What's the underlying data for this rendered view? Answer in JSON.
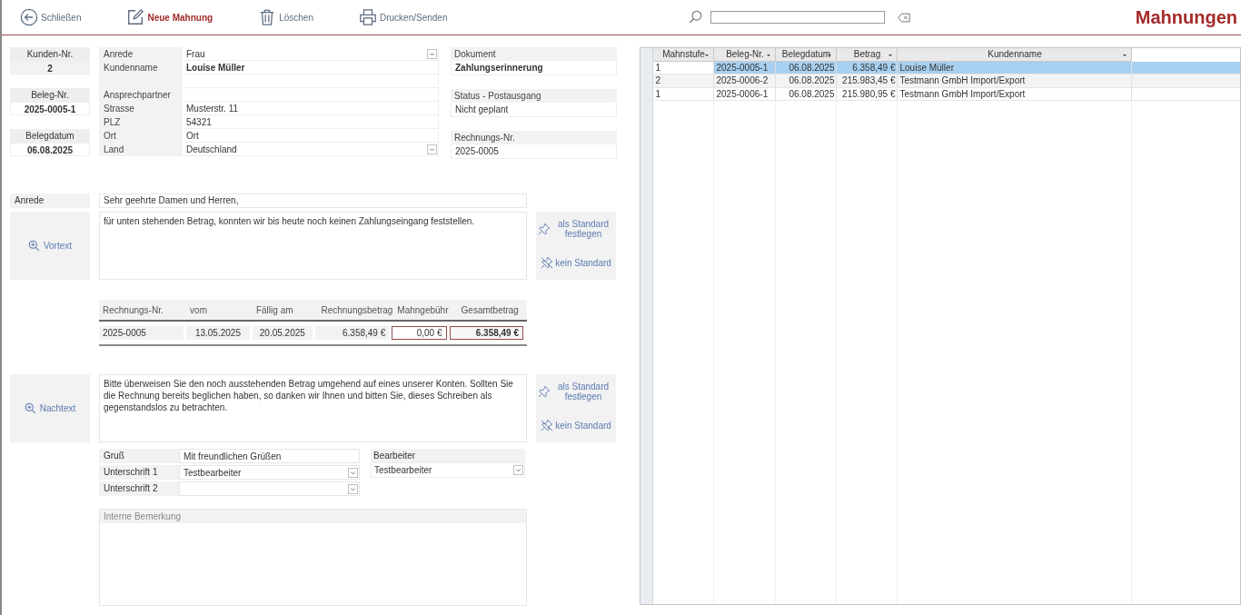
{
  "toolbar": {
    "buttons": [
      {
        "kind": "close",
        "label": "Schließen",
        "selected": false
      },
      {
        "kind": "new",
        "label": "Neue Mahnung",
        "selected": true
      },
      {
        "kind": "delete",
        "label": "Löschen",
        "selected": false
      },
      {
        "kind": "print",
        "label": "Drucken/Senden",
        "selected": false
      }
    ],
    "title": "Mahnungen"
  },
  "ids": [
    {
      "label": "Kunden-Nr.",
      "value": "2"
    },
    {
      "label": "Beleg-Nr.",
      "value": "2025-0005-1"
    },
    {
      "label": "Belegdatum",
      "value": "06.08.2025"
    }
  ],
  "address": [
    {
      "kind": "combo",
      "label": "Anrede",
      "value": "Frau",
      "bold": false
    },
    {
      "kind": "text",
      "label": "Kundenname",
      "value": "Louise Müller",
      "bold": true
    },
    {
      "kind": "blank"
    },
    {
      "kind": "text",
      "label": "Ansprechpartner"
    },
    {
      "kind": "text",
      "label": "Strasse",
      "value": "Musterstr. 11",
      "bold": false
    },
    {
      "kind": "text",
      "label": "PLZ",
      "value": "54321",
      "bold": false
    },
    {
      "kind": "text",
      "label": "Ort",
      "value": "Ort",
      "bold": false
    },
    {
      "kind": "combo",
      "label": "Land",
      "value": "Deutschland",
      "bold": false
    }
  ],
  "info": [
    {
      "label": "Dokument",
      "value": "Zahlungserinnerung",
      "bold": true
    },
    {
      "label": "Status - Postausgang",
      "value": "Nicht geplant",
      "bold": false
    },
    {
      "label": "Rechnungs-Nr.",
      "value": "2025-0005",
      "bold": false
    }
  ],
  "intro": {
    "salutation_label": "Anrede",
    "salutation": "Sehr geehrte Damen und Herren,",
    "button": "Vortext",
    "text": "für unten stehenden Betrag, konnten wir bis heute noch keinen Zahlungseingang feststellen.",
    "set_default": "als Standard festlegen",
    "no_default": "kein Standard"
  },
  "invoice": {
    "columns": [
      "Rechnungs-Nr.",
      "vom",
      "Fällig am",
      "Rechnungsbetrag",
      "Mahngebühr",
      "Gesamtbetrag"
    ],
    "row": [
      "2025-0005",
      "13.05.2025",
      "20.05.2025",
      "6.358,49 €",
      "0,00 €",
      "6.358,49 €"
    ]
  },
  "closing": {
    "button": "Nachtext",
    "text": "Bitte überweisen Sie den noch ausstehenden Betrag umgehend auf eines unserer Konten. Sollten Sie die Rechnung bereits beglichen haben, so danken wir Ihnen und bitten Sie, dieses Schreiben als gegenstandslos zu betrachten.",
    "set_default": "als Standard festlegen",
    "no_default": "kein Standard"
  },
  "signature": [
    {
      "kind": "text",
      "label": "Gruß",
      "value": "Mit freundlichen Grüßen"
    },
    {
      "kind": "combo",
      "label": "Unterschrift 1",
      "value": "Testbearbeiter"
    },
    {
      "kind": "combo",
      "label": "Unterschrift 2"
    }
  ],
  "editor": {
    "label": "Bearbeiter",
    "value": "Testbearbeiter"
  },
  "remark": {
    "label": "Interne Bemerkung"
  },
  "datasheet": {
    "columns": [
      "Mahnstufe",
      "Beleg-Nr.",
      "Belegdatum",
      "Betrag",
      "Kundenname"
    ],
    "rows": [
      {
        "cells": [
          "1",
          "2025-0005-1",
          "06.08.2025",
          "6.358,49 €",
          "Louise Müller"
        ],
        "selected": true
      },
      {
        "cells": [
          "2",
          "2025-0006-2",
          "06.08.2025",
          "215.983,45 €",
          "Testmann GmbH Import/Export"
        ],
        "selected": false
      },
      {
        "cells": [
          "1",
          "2025-0006-1",
          "06.08.2025",
          "215.980,95 €",
          "Testmann GmbH Import/Export"
        ],
        "selected": false
      }
    ]
  }
}
